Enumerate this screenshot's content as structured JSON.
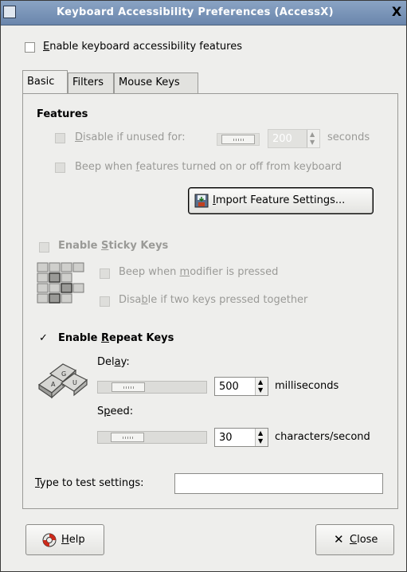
{
  "window": {
    "title": "Keyboard Accessibility Preferences (AccessX)",
    "close_glyph": "X"
  },
  "enable_accessibility": {
    "pre": "",
    "mnemonic": "E",
    "post": "nable keyboard accessibility features",
    "checked": false
  },
  "tabs": [
    {
      "label": "Basic",
      "active": true
    },
    {
      "label": "Filters",
      "active": false
    },
    {
      "label": "Mouse Keys",
      "active": false
    }
  ],
  "features": {
    "heading": "Features",
    "disable_unused": {
      "pre": "",
      "mnemonic": "D",
      "post": "isable if unused for:",
      "spin_value": "200",
      "unit": "seconds",
      "checked": false,
      "enabled": false
    },
    "beep_features": {
      "pre": "Beep when ",
      "mnemonic": "f",
      "post": "eatures turned on or off from keyboard",
      "checked": false,
      "enabled": false
    },
    "import_button": {
      "pre": "",
      "mnemonic": "I",
      "post": "mport Feature Settings..."
    }
  },
  "sticky_keys": {
    "pre": "Enable ",
    "mnemonic": "S",
    "post": "ticky Keys",
    "checked": false,
    "enabled": false,
    "beep_modifier": {
      "pre": "Beep when ",
      "mnemonic": "m",
      "post": "odifier is pressed"
    },
    "disable_two_keys": {
      "pre": "Disa",
      "mnemonic": "b",
      "post": "le if two keys pressed together"
    }
  },
  "repeat_keys": {
    "pre": "Enable ",
    "mnemonic": "R",
    "post": "epeat Keys",
    "checked": true,
    "delay": {
      "pre": "Del",
      "mnemonic": "a",
      "post": "y:",
      "value": "500",
      "unit": "milliseconds",
      "level": 0.18
    },
    "speed": {
      "pre": "S",
      "mnemonic": "p",
      "post": "eed:",
      "value": "30",
      "unit": "characters/second",
      "level": 0.17
    }
  },
  "test": {
    "pre": "",
    "mnemonic": "T",
    "post": "ype to test settings:",
    "value": ""
  },
  "buttons": {
    "help": {
      "pre": "",
      "mnemonic": "H",
      "post": "elp"
    },
    "close": {
      "pre": "",
      "mnemonic": "C",
      "post": "lose"
    }
  }
}
